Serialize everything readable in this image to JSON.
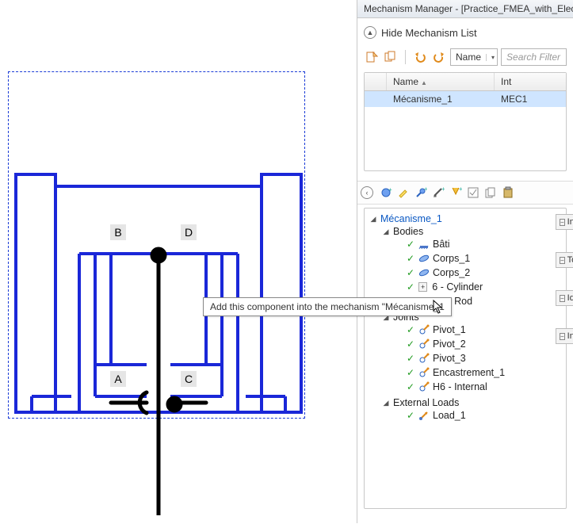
{
  "panel": {
    "title": "Mechanism Manager - [Practice_FMEA_with_Electro_Hy",
    "hide_label": "Hide Mechanism List",
    "name_combo": "Name",
    "search_placeholder": "Search Filter",
    "grid": {
      "col_name": "Name",
      "col_int": "Int",
      "row_name": "Mécanisme_1",
      "row_int": "MEC1"
    }
  },
  "tree": {
    "root": "Mécanisme_1",
    "bodies_label": "Bodies",
    "bodies": [
      {
        "label": "Bâti"
      },
      {
        "label": "Corps_1"
      },
      {
        "label": "Corps_2"
      },
      {
        "label": "6 - Cylinder",
        "new": true
      },
      {
        "label": "H6 - Rod"
      }
    ],
    "joints_label": "Joints",
    "joints": [
      {
        "label": "Pivot_1"
      },
      {
        "label": "Pivot_2"
      },
      {
        "label": "Pivot_3"
      },
      {
        "label": "Encastrement_1"
      },
      {
        "label": "H6 - Internal"
      }
    ],
    "external_label": "External Loads",
    "external": [
      {
        "label": "Load_1"
      }
    ]
  },
  "side_tabs": {
    "a": "In",
    "b": "To",
    "c": "Id",
    "d": "In"
  },
  "tooltip": "Add this component into the mechanism \"Mécanisme_1",
  "diagram_labels": {
    "a": "A",
    "b": "B",
    "c": "C",
    "d": "D"
  }
}
